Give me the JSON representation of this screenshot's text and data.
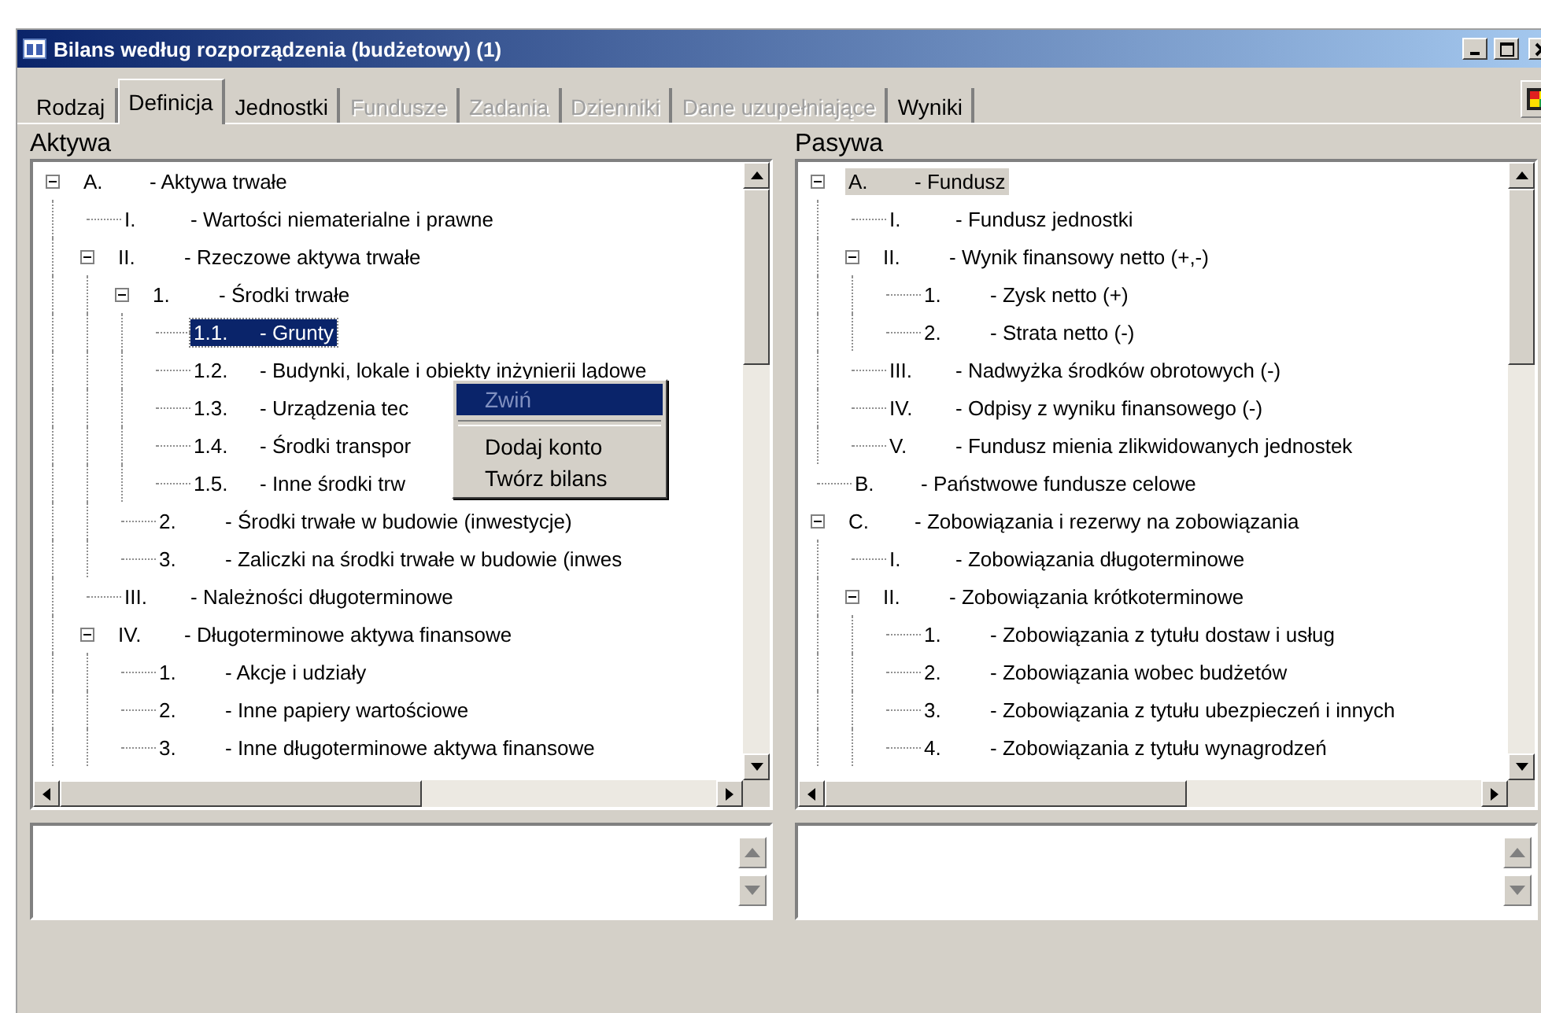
{
  "window": {
    "title": "Bilans według rozporządzenia (budżetowy) (1)"
  },
  "tabs": [
    {
      "label": "Rodzaj",
      "selected": false,
      "disabled": false
    },
    {
      "label": "Definicja",
      "selected": true,
      "disabled": false
    },
    {
      "label": "Jednostki",
      "selected": false,
      "disabled": false
    },
    {
      "label": "Fundusze",
      "selected": false,
      "disabled": true
    },
    {
      "label": "Zadania",
      "selected": false,
      "disabled": true
    },
    {
      "label": "Dzienniki",
      "selected": false,
      "disabled": true
    },
    {
      "label": "Dane uzupełniające",
      "selected": false,
      "disabled": true
    },
    {
      "label": "Wyniki",
      "selected": false,
      "disabled": false
    }
  ],
  "panels": [
    {
      "title": "Aktywa",
      "focused": true,
      "tree": [
        {
          "number": "A.",
          "label": "- Aktywa trwałe",
          "selected": false,
          "expanded": true,
          "children": [
            {
              "number": "I.",
              "label": "- Wartości niematerialne i prawne",
              "selected": false
            },
            {
              "number": "II.",
              "label": "- Rzeczowe aktywa trwałe",
              "selected": false,
              "expanded": true,
              "children": [
                {
                  "number": "1.",
                  "label": "- Środki trwałe",
                  "selected": false,
                  "expanded": true,
                  "children": [
                    {
                      "number": "1.1.",
                      "label": "- Grunty",
                      "selected": true
                    },
                    {
                      "number": "1.2.",
                      "label": "- Budynki, lokale i obiekty inżynierii lądowe",
                      "selected": false
                    },
                    {
                      "number": "1.3.",
                      "label": "- Urządzenia tec",
                      "selected": false
                    },
                    {
                      "number": "1.4.",
                      "label": "- Środki transpor",
                      "selected": false
                    },
                    {
                      "number": "1.5.",
                      "label": "- Inne środki trw",
                      "selected": false
                    }
                  ]
                },
                {
                  "number": "2.",
                  "label": "- Środki trwałe w budowie (inwestycje)",
                  "selected": false
                },
                {
                  "number": "3.",
                  "label": "- Zaliczki na środki trwałe w budowie (inwes",
                  "selected": false
                }
              ]
            },
            {
              "number": "III.",
              "label": "- Należności długoterminowe",
              "selected": false
            },
            {
              "number": "IV.",
              "label": "- Długoterminowe aktywa finansowe",
              "selected": false,
              "expanded": true,
              "children": [
                {
                  "number": "1.",
                  "label": "- Akcje i udziały",
                  "selected": false
                },
                {
                  "number": "2.",
                  "label": "- Inne papiery wartościowe",
                  "selected": false
                },
                {
                  "number": "3.",
                  "label": "- Inne długoterminowe aktywa finansowe",
                  "selected": false
                }
              ]
            }
          ]
        }
      ]
    },
    {
      "title": "Pasywa",
      "focused": false,
      "tree": [
        {
          "number": "A.",
          "label": "- Fundusz",
          "selected": true,
          "expanded": true,
          "children": [
            {
              "number": "I.",
              "label": "- Fundusz jednostki",
              "selected": false
            },
            {
              "number": "II.",
              "label": "- Wynik finansowy netto (+,-)",
              "selected": false,
              "expanded": true,
              "children": [
                {
                  "number": "1.",
                  "label": "- Zysk netto (+)",
                  "selected": false
                },
                {
                  "number": "2.",
                  "label": "- Strata netto (-)",
                  "selected": false
                }
              ]
            },
            {
              "number": "III.",
              "label": "- Nadwyżka środków obrotowych (-)",
              "selected": false
            },
            {
              "number": "IV.",
              "label": "- Odpisy z wyniku finansowego (-)",
              "selected": false
            },
            {
              "number": "V.",
              "label": "- Fundusz mienia zlikwidowanych jednostek",
              "selected": false
            }
          ]
        },
        {
          "number": "B.",
          "label": "- Państwowe fundusze celowe",
          "selected": false
        },
        {
          "number": "C.",
          "label": "- Zobowiązania i rezerwy na zobowiązania",
          "selected": false,
          "expanded": true,
          "children": [
            {
              "number": "I.",
              "label": "- Zobowiązania długoterminowe",
              "selected": false
            },
            {
              "number": "II.",
              "label": "- Zobowiązania krótkoterminowe",
              "selected": false,
              "expanded": true,
              "children": [
                {
                  "number": "1.",
                  "label": "- Zobowiązania z tytułu dostaw i usług",
                  "selected": false
                },
                {
                  "number": "2.",
                  "label": "- Zobowiązania wobec budżetów",
                  "selected": false
                },
                {
                  "number": "3.",
                  "label": "- Zobowiązania z tytułu ubezpieczeń i innych",
                  "selected": false
                },
                {
                  "number": "4.",
                  "label": "- Zobowiązania z tytułu wynagrodzeń",
                  "selected": false
                }
              ]
            }
          ]
        }
      ]
    }
  ],
  "context_menu": {
    "items": [
      {
        "label": "Zwiń",
        "selected": true,
        "disabled": true
      },
      {
        "kind": "separator"
      },
      {
        "label": "Dodaj konto",
        "selected": false,
        "disabled": false
      },
      {
        "label": "Twórz bilans",
        "selected": false,
        "disabled": false
      }
    ]
  }
}
